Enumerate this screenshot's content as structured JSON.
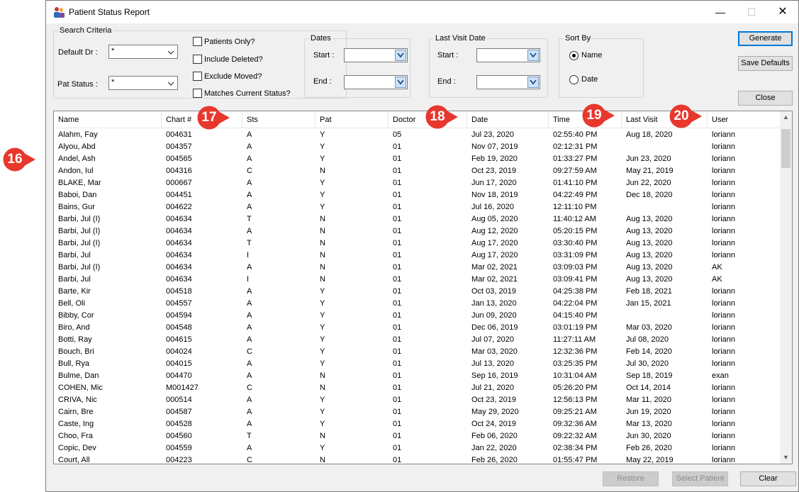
{
  "window": {
    "title": "Patient Status Report",
    "minimize": "—",
    "maximize": "☐",
    "close": "✕"
  },
  "search": {
    "legend": "Search Criteria",
    "default_dr_label": "Default Dr :",
    "default_dr_value": "*",
    "pat_status_label": "Pat Status :",
    "pat_status_value": "*"
  },
  "checks": [
    {
      "label": "Patients Only?",
      "checked": false
    },
    {
      "label": "Include Deleted?",
      "checked": false
    },
    {
      "label": "Exclude Moved?",
      "checked": false
    },
    {
      "label": "Matches Current Status?",
      "checked": false
    }
  ],
  "dates": {
    "legend": "Dates",
    "start_label": "Start :",
    "end_label": "End :",
    "start_value": "",
    "end_value": ""
  },
  "last_visit": {
    "legend": "Last Visit Date",
    "start_label": "Start :",
    "end_label": "End :",
    "start_value": "",
    "end_value": ""
  },
  "sort_by": {
    "legend": "Sort By",
    "name_label": "Name",
    "date_label": "Date",
    "selected": "Name"
  },
  "buttons": {
    "generate": "Generate",
    "save_defaults": "Save Defaults",
    "close": "Close",
    "restore": "Restore",
    "select_patient": "Select Patient",
    "clear": "Clear"
  },
  "columns": [
    "Name",
    "Chart #",
    "Sts",
    "Pat",
    "Doctor",
    "Date",
    "Time",
    "Last Visit",
    "User"
  ],
  "rows": [
    [
      "Alahm, Fay",
      "004631",
      "A",
      "Y",
      "05",
      "Jul 23, 2020",
      "02:55:40 PM",
      "Aug 18, 2020",
      "loriann"
    ],
    [
      "Alyou, Abd",
      "004357",
      "A",
      "Y",
      "01",
      "Nov 07, 2019",
      "02:12:31 PM",
      "",
      "loriann"
    ],
    [
      "Andel, Ash",
      "004565",
      "A",
      "Y",
      "01",
      "Feb 19, 2020",
      "01:33:27 PM",
      "Jun 23, 2020",
      "loriann"
    ],
    [
      "Andon, Iul",
      "004316",
      "C",
      "N",
      "01",
      "Oct 23, 2019",
      "09:27:59 AM",
      "May 21, 2019",
      "loriann"
    ],
    [
      "BLAKE, Mar",
      "000667",
      "A",
      "Y",
      "01",
      "Jun 17, 2020",
      "01:41:10 PM",
      "Jun 22, 2020",
      "loriann"
    ],
    [
      "Baboi, Dan",
      "004451",
      "A",
      "Y",
      "01",
      "Nov 18, 2019",
      "04:22:49 PM",
      "Dec 18, 2020",
      "loriann"
    ],
    [
      "Bains, Gur",
      "004622",
      "A",
      "Y",
      "01",
      "Jul 16, 2020",
      "12:11:10 PM",
      "",
      "loriann"
    ],
    [
      "Barbi, Jul (I)",
      "004634",
      "T",
      "N",
      "01",
      "Aug 05, 2020",
      "11:40:12 AM",
      "Aug 13, 2020",
      "loriann"
    ],
    [
      "Barbi, Jul (I)",
      "004634",
      "A",
      "N",
      "01",
      "Aug 12, 2020",
      "05:20:15 PM",
      "Aug 13, 2020",
      "loriann"
    ],
    [
      "Barbi, Jul (I)",
      "004634",
      "T",
      "N",
      "01",
      "Aug 17, 2020",
      "03:30:40 PM",
      "Aug 13, 2020",
      "loriann"
    ],
    [
      "Barbi, Jul",
      "004634",
      "I",
      "N",
      "01",
      "Aug 17, 2020",
      "03:31:09 PM",
      "Aug 13, 2020",
      "loriann"
    ],
    [
      "Barbi, Jul (I)",
      "004634",
      "A",
      "N",
      "01",
      "Mar 02, 2021",
      "03:09:03 PM",
      "Aug 13, 2020",
      "AK"
    ],
    [
      "Barbi, Jul",
      "004634",
      "I",
      "N",
      "01",
      "Mar 02, 2021",
      "03:09:41 PM",
      "Aug 13, 2020",
      "AK"
    ],
    [
      "Barte, Kir",
      "004518",
      "A",
      "Y",
      "01",
      "Oct 03, 2019",
      "04:25:38 PM",
      "Feb 18, 2021",
      "loriann"
    ],
    [
      "Bell, Oli",
      "004557",
      "A",
      "Y",
      "01",
      "Jan 13, 2020",
      "04:22:04 PM",
      "Jan 15, 2021",
      "loriann"
    ],
    [
      "Bibby, Cor",
      "004594",
      "A",
      "Y",
      "01",
      "Jun 09, 2020",
      "04:15:40 PM",
      "",
      "loriann"
    ],
    [
      "Biro, And",
      "004548",
      "A",
      "Y",
      "01",
      "Dec 06, 2019",
      "03:01:19 PM",
      "Mar 03, 2020",
      "loriann"
    ],
    [
      "Botti, Ray",
      "004615",
      "A",
      "Y",
      "01",
      "Jul 07, 2020",
      "11:27:11 AM",
      "Jul 08, 2020",
      "loriann"
    ],
    [
      "Bouch, Bri",
      "004024",
      "C",
      "Y",
      "01",
      "Mar 03, 2020",
      "12:32:36 PM",
      "Feb 14, 2020",
      "loriann"
    ],
    [
      "Bull, Rya",
      "004015",
      "A",
      "Y",
      "01",
      "Jul 13, 2020",
      "03:25:35 PM",
      "Jul 30, 2020",
      "loriann"
    ],
    [
      "Bulme, Dan",
      "004470",
      "A",
      "N",
      "01",
      "Sep 16, 2019",
      "10:31:04 AM",
      "Sep 18, 2019",
      "exan"
    ],
    [
      "COHEN, Mic",
      "M001427",
      "C",
      "N",
      "01",
      "Jul 21, 2020",
      "05:26:20 PM",
      "Oct 14, 2014",
      "loriann"
    ],
    [
      "CRIVA, Nic",
      "000514",
      "A",
      "Y",
      "01",
      "Oct 23, 2019",
      "12:56:13 PM",
      "Mar 11, 2020",
      "loriann"
    ],
    [
      "Cairn, Bre",
      "004587",
      "A",
      "Y",
      "01",
      "May 29, 2020",
      "09:25:21 AM",
      "Jun 19, 2020",
      "loriann"
    ],
    [
      "Caste, Ing",
      "004528",
      "A",
      "Y",
      "01",
      "Oct 24, 2019",
      "09:32:36 AM",
      "Mar 13, 2020",
      "loriann"
    ],
    [
      "Choo, Fra",
      "004560",
      "T",
      "N",
      "01",
      "Feb 06, 2020",
      "09:22:32 AM",
      "Jun 30, 2020",
      "loriann"
    ],
    [
      "Copic, Dev",
      "004559",
      "A",
      "Y",
      "01",
      "Jan 22, 2020",
      "02:38:34 PM",
      "Feb 26, 2020",
      "loriann"
    ],
    [
      "Court, All",
      "004223",
      "C",
      "N",
      "01",
      "Feb 26, 2020",
      "01:55:47 PM",
      "May 22, 2019",
      "loriann"
    ]
  ],
  "callouts": [
    "16",
    "17",
    "18",
    "19",
    "20"
  ],
  "colors": {
    "callout": "#e8372c",
    "focus": "#0078d7"
  }
}
